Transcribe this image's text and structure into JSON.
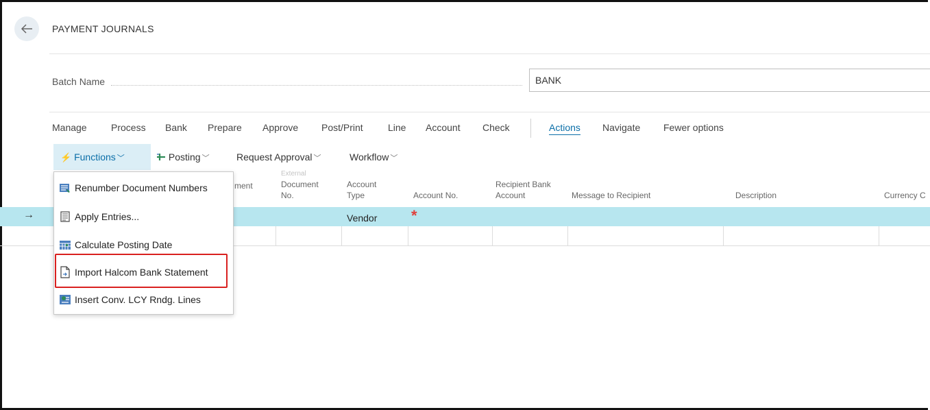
{
  "page": {
    "title": "PAYMENT JOURNALS"
  },
  "icons": {
    "back": "back-arrow-icon",
    "row_arrow": "row-arrow-icon"
  },
  "batch": {
    "label": "Batch Name",
    "value": "BANK"
  },
  "tabs": [
    "Manage",
    "Process",
    "Bank",
    "Prepare",
    "Approve",
    "Post/Print",
    "Line",
    "Account",
    "Check",
    "Actions",
    "Navigate",
    "Fewer options"
  ],
  "subbar": {
    "functions": "Functions",
    "posting": "Posting",
    "request_approval": "Request Approval",
    "workflow": "Workflow"
  },
  "columns": {
    "document_type_partial": "ment",
    "external_doc": [
      "External",
      "Document",
      "No."
    ],
    "account_type": [
      "Account",
      "Type"
    ],
    "account_no": "Account No.",
    "recipient_bank": [
      "Recipient Bank",
      "Account"
    ],
    "message": "Message to Recipient",
    "description": "Description",
    "currency": "Currency C"
  },
  "row": {
    "account_type": "Vendor",
    "account_no_required": "*"
  },
  "menu": [
    {
      "label": "Renumber Document Numbers",
      "icon": "renumber-icon"
    },
    {
      "label": "Apply Entries...",
      "icon": "apply-entries-icon"
    },
    {
      "label": "Calculate Posting Date",
      "icon": "calendar-icon"
    },
    {
      "label": "Import Halcom Bank Statement",
      "icon": "import-file-icon"
    },
    {
      "label": "Insert Conv. LCY Rndg. Lines",
      "icon": "insert-lines-icon"
    }
  ],
  "colors": {
    "accent": "#0a6ea8",
    "selected_row": "#b7e6ef",
    "highlight": "#d9201f"
  }
}
